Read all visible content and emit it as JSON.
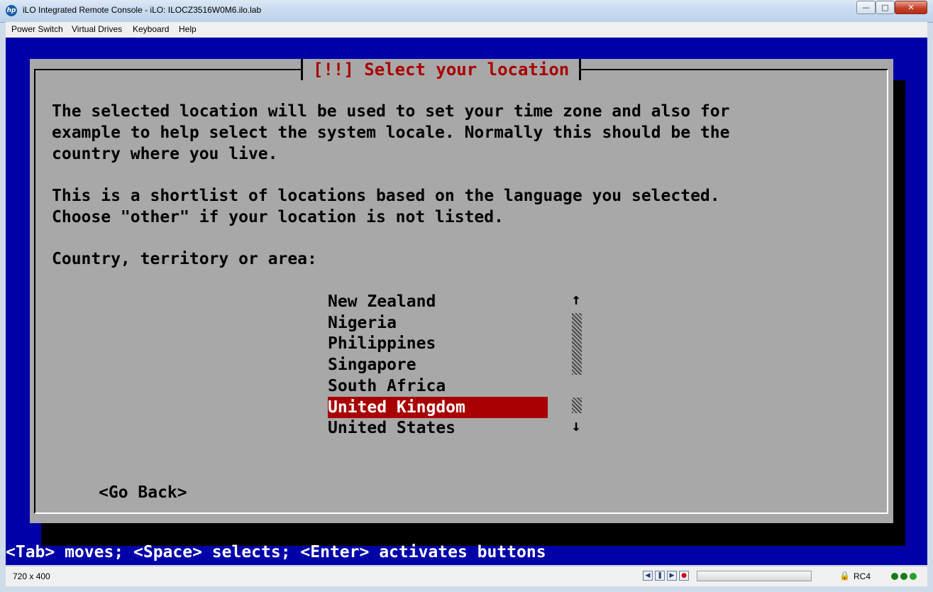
{
  "window": {
    "title": "iLO Integrated Remote Console - iLO: ILOCZ3516W0M6.ilo.lab",
    "logo_text": "hp",
    "controls": [
      "minimize-icon",
      "maximize-icon",
      "close-icon"
    ]
  },
  "menubar": {
    "items": [
      "Power Switch",
      "Virtual Drives",
      "Keyboard",
      "Help"
    ]
  },
  "dialog": {
    "title": "[!!] Select your location",
    "paragraph1": [
      "The selected location will be used to set your time zone and also for",
      "example to help select the system locale. Normally this should be the",
      "country where you live."
    ],
    "paragraph2": [
      "This is a shortlist of locations based on the language you selected.",
      "Choose \"other\" if your location is not listed."
    ],
    "prompt": "Country, territory or area:",
    "options": [
      "New Zealand",
      "Nigeria",
      "Philippines",
      "Singapore",
      "South Africa",
      "United Kingdom",
      "United States"
    ],
    "selected_index": 5,
    "scroll_up_glyph": "↑",
    "scroll_down_glyph": "↓",
    "go_back": "<Go Back>"
  },
  "helpline": "<Tab> moves; <Space> selects; <Enter> activates buttons",
  "statusbar": {
    "resolution": "720 x 400",
    "encryption": "RC4",
    "leds": [
      "#1a7a1a",
      "#1a7a1a",
      "#2aa12a"
    ]
  }
}
